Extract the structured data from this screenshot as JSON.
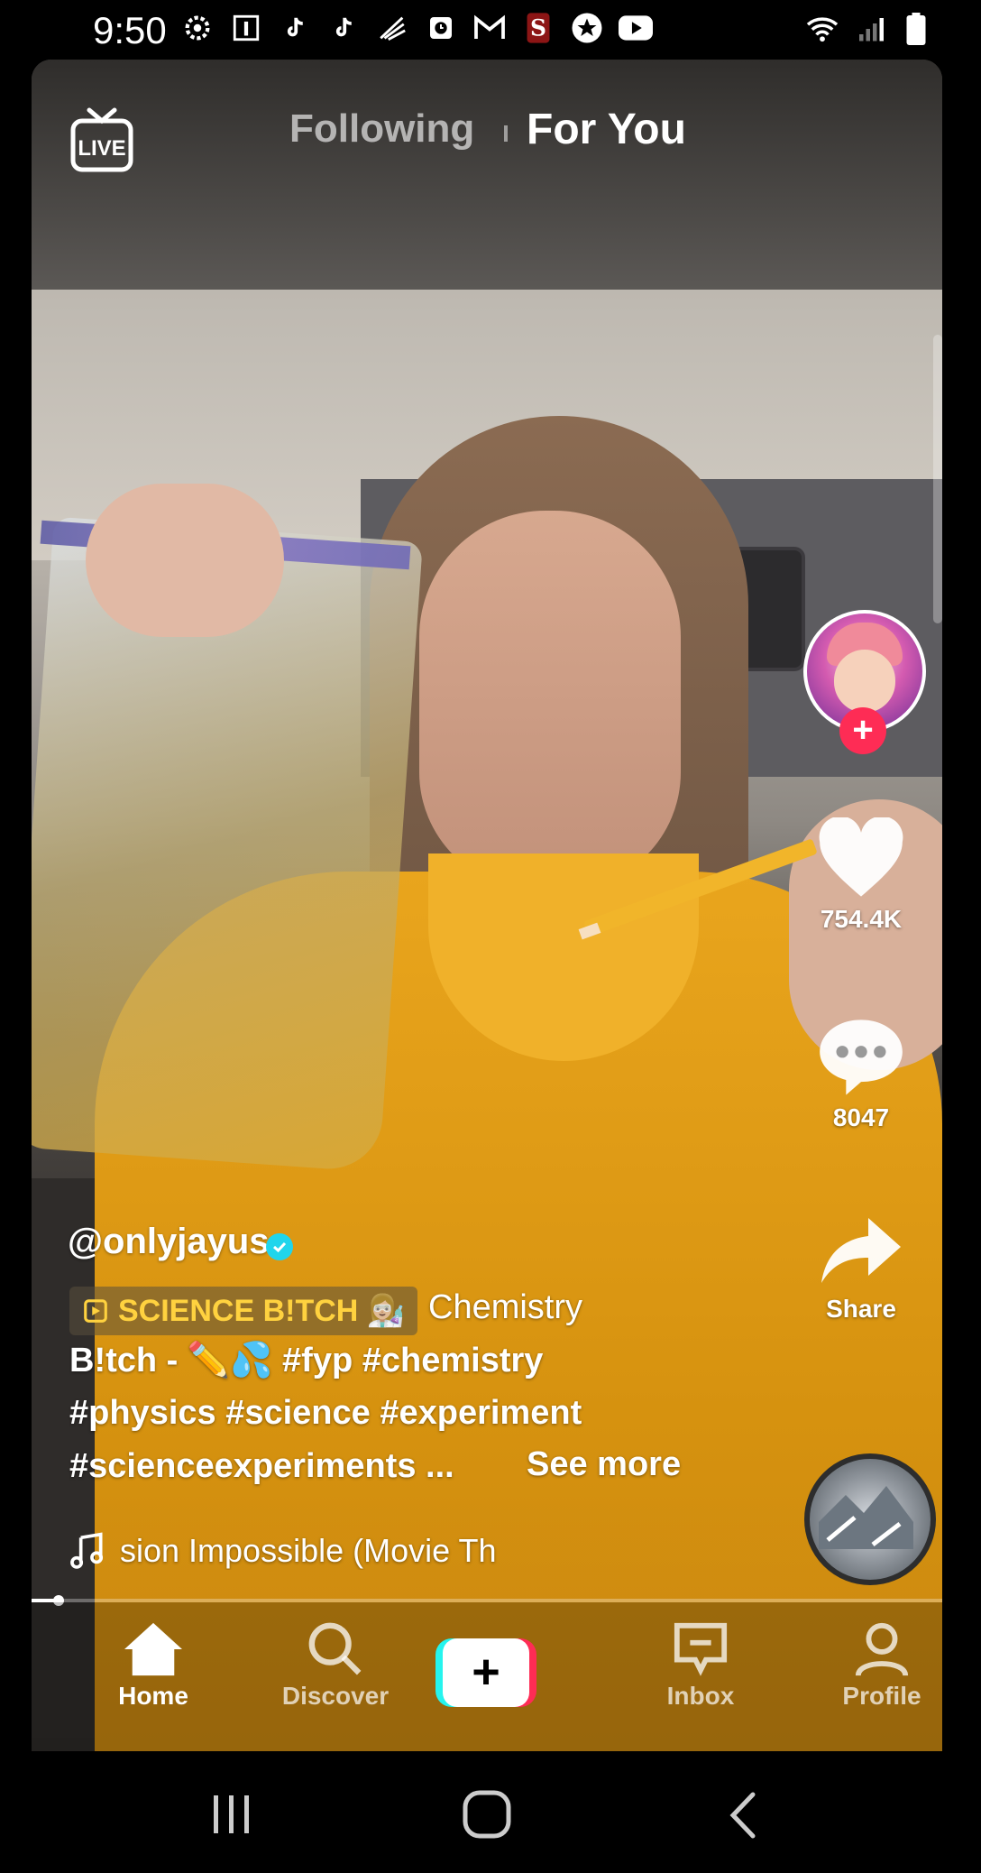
{
  "status_bar": {
    "time": "9:50",
    "icons": [
      "gear-icon",
      "info-icon",
      "tiktok-icon",
      "tiktok-icon",
      "sprint-icon",
      "clock-icon",
      "gmail-icon",
      "stanford-icon",
      "star-icon",
      "youtube-icon"
    ],
    "right_icons": [
      "wifi-icon",
      "signal-icon",
      "battery-icon"
    ]
  },
  "top_nav": {
    "live_label": "LIVE",
    "following": "Following",
    "for_you": "For You"
  },
  "right_rail": {
    "likes": "754.4K",
    "comments": "8047",
    "share": "Share"
  },
  "caption": {
    "username": "@onlyjayus",
    "effect_label": "SCIENCE B!TCH 👩🏼‍🔬",
    "line1_rest": "Chemistry",
    "line2": "B!tch - ✏️💦 #fyp #chemistry",
    "line3": "#physics #science #experiment",
    "line4": "#scienceexperiments ...",
    "see_more": "See more",
    "music": "sion Impossible (Movie Th"
  },
  "progress": {
    "fraction": 0.03
  },
  "bottom_nav": {
    "home": "Home",
    "discover": "Discover",
    "create": "+",
    "inbox": "Inbox",
    "profile": "Profile"
  },
  "colors": {
    "accent_red": "#fe2c55",
    "accent_cyan": "#25f4ee",
    "effect_yellow": "#ffd23f",
    "verified_blue": "#20d5ec"
  }
}
